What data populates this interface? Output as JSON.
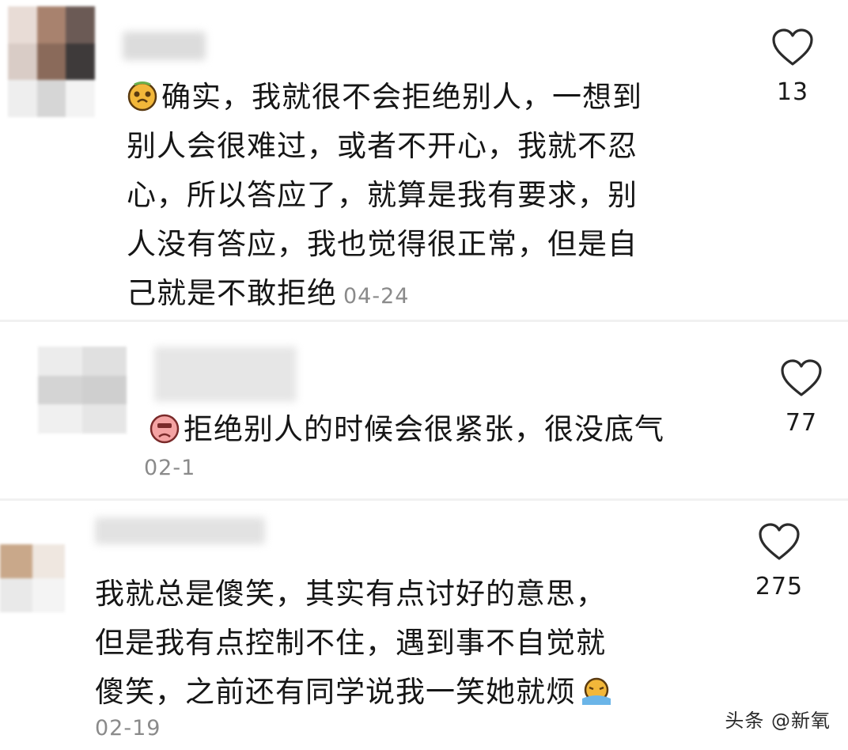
{
  "comments": [
    {
      "lines": [
        "确实，我就很不会拒绝别人，一想到",
        "别人会很难过，或者不开心，我就不忍",
        "心，所以答应了，就算是我有要求，别",
        "人没有答应，我也觉得很正常，但是自",
        "己就是不敢拒绝"
      ],
      "date": "04-24",
      "likes": "13",
      "emoji": "face-emoji"
    },
    {
      "lines": [
        "拒绝别人的时候会很紧张，很没底气"
      ],
      "date": "02-1",
      "likes": "77",
      "emoji": "sad-face-emoji"
    },
    {
      "lines": [
        "我就总是傻笑，其实有点讨好的意思，",
        "但是我有点控制不住，遇到事不自觉就",
        "傻笑，之前还有同学说我一笑她就烦"
      ],
      "date": "02-19",
      "likes": "275",
      "emoji": "crying-emoji"
    }
  ],
  "watermark": "头条 @新氧",
  "colors": {
    "text": "#161616",
    "date": "#8a8a8a",
    "heart_outline": "#2b2b2b"
  }
}
